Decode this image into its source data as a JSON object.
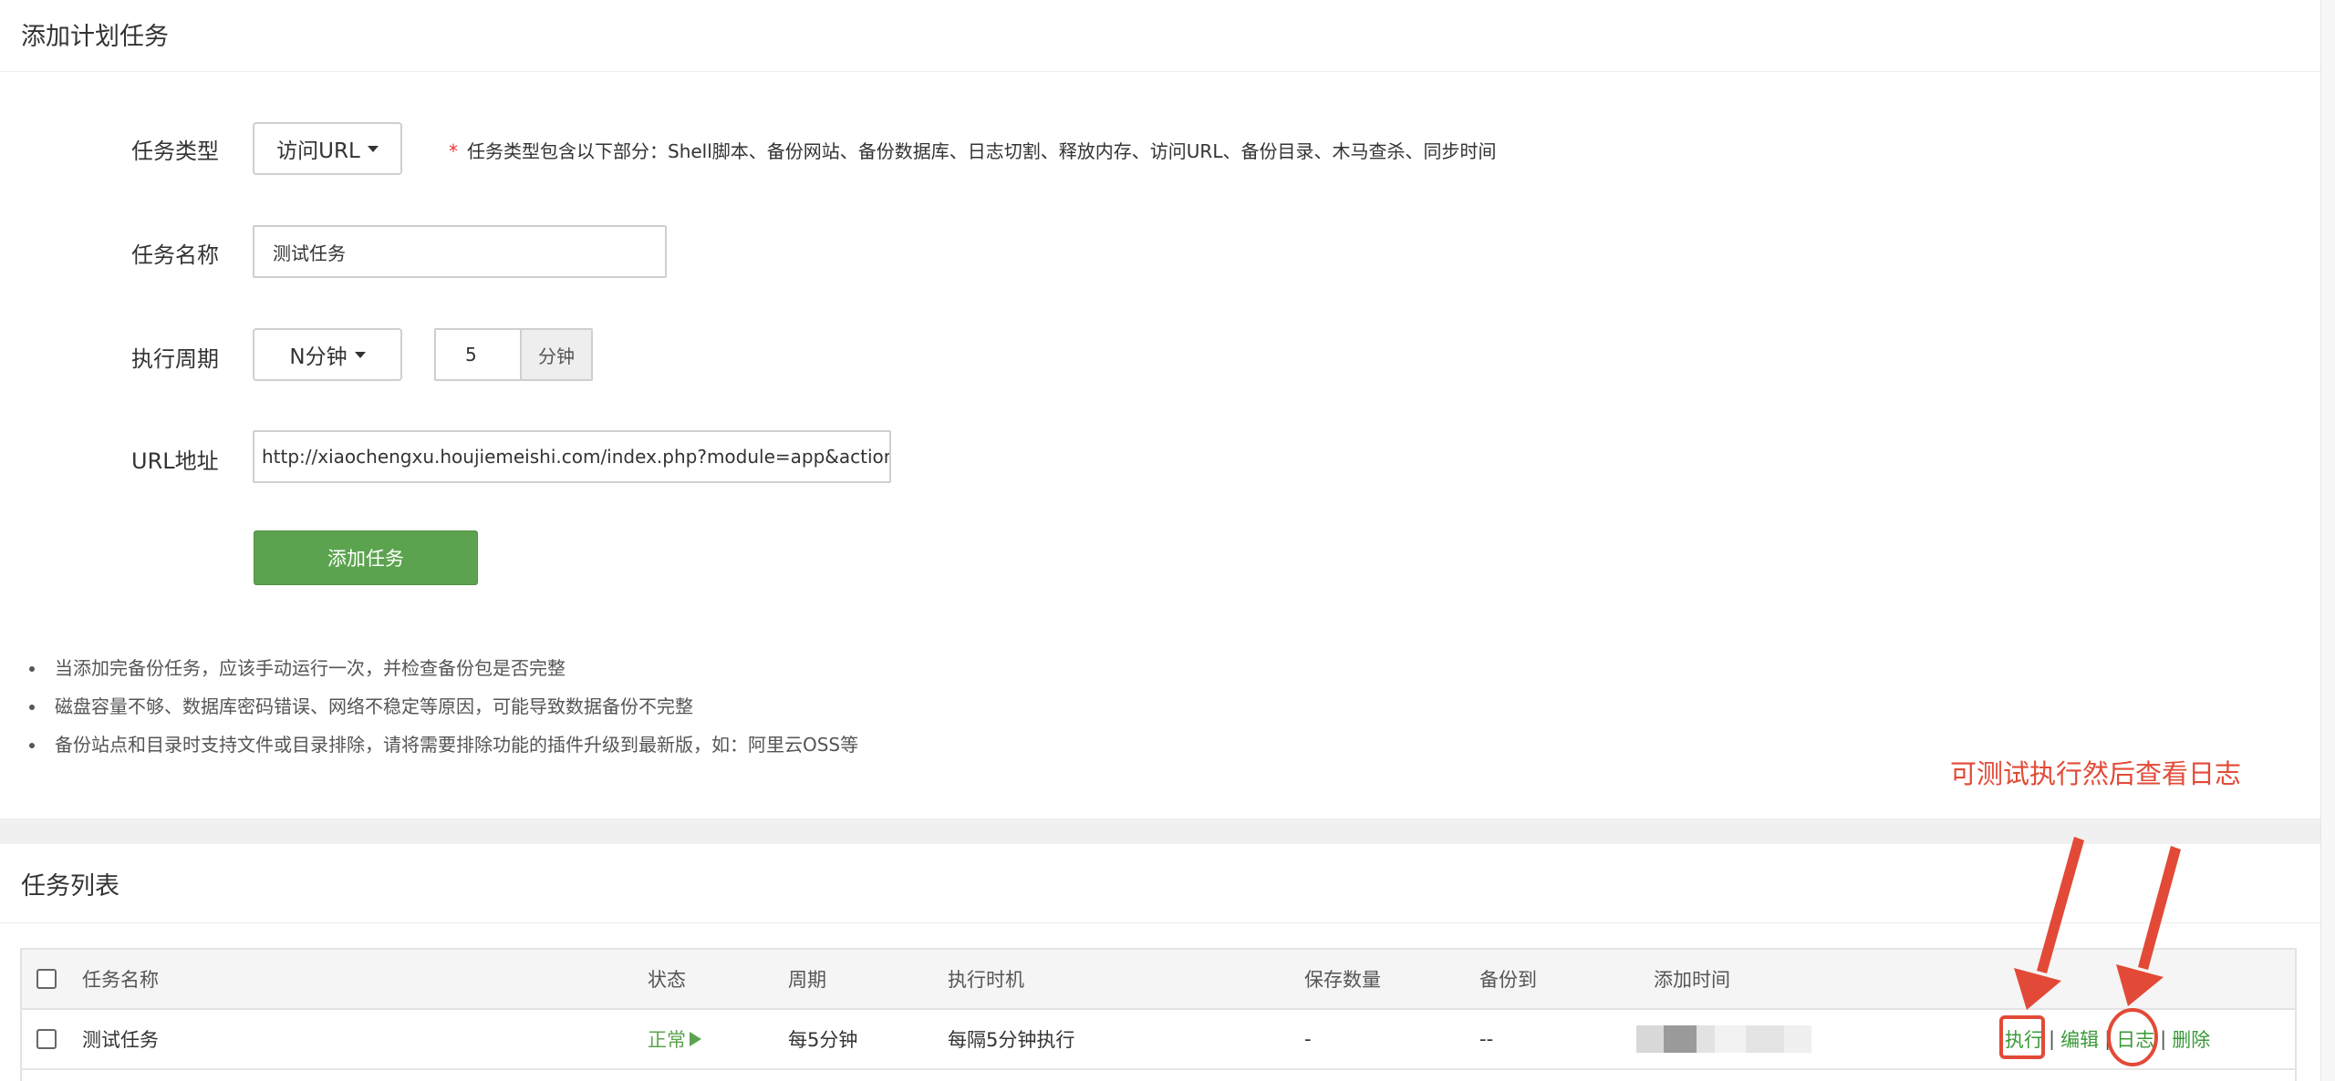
{
  "add_panel": {
    "title": "添加计划任务",
    "task_type": {
      "label": "任务类型",
      "value": "访问URL",
      "hint_star": "*",
      "hint": "任务类型包含以下部分：Shell脚本、备份网站、备份数据库、日志切割、释放内存、访问URL、备份目录、木马查杀、同步时间"
    },
    "task_name": {
      "label": "任务名称",
      "value": "测试任务"
    },
    "period": {
      "label": "执行周期",
      "type_value": "N分钟",
      "minutes_value": "5",
      "unit": "分钟"
    },
    "url": {
      "label": "URL地址",
      "value": "http://xiaochengxu.houjiemeishi.com/index.php?module=app&action=test"
    },
    "submit_label": "添加任务",
    "tips": [
      "当添加完备份任务，应该手动运行一次，并检查备份包是否完整",
      "磁盘容量不够、数据库密码错误、网络不稳定等原因，可能导致数据备份不完整",
      "备份站点和目录时支持文件或目录排除，请将需要排除功能的插件升级到最新版，如：阿里云OSS等"
    ]
  },
  "annotation": {
    "text": "可测试执行然后查看日志",
    "color": "#e24a37"
  },
  "list_panel": {
    "title": "任务列表",
    "columns": [
      "任务名称",
      "状态",
      "周期",
      "执行时机",
      "保存数量",
      "备份到",
      "添加时间"
    ],
    "rows": [
      {
        "name": "测试任务",
        "status": "正常",
        "period": "每5分钟",
        "timing": "每隔5分钟执行",
        "save_count": "-",
        "backup_to": "--",
        "ops": {
          "run": "执行",
          "sep": "|",
          "edit": "编辑",
          "log": "日志",
          "delete": "删除"
        }
      }
    ]
  },
  "colors": {
    "primary_green": "#5ca34f",
    "link_green": "#3a9a3a",
    "annotation_red": "#e24a37"
  }
}
